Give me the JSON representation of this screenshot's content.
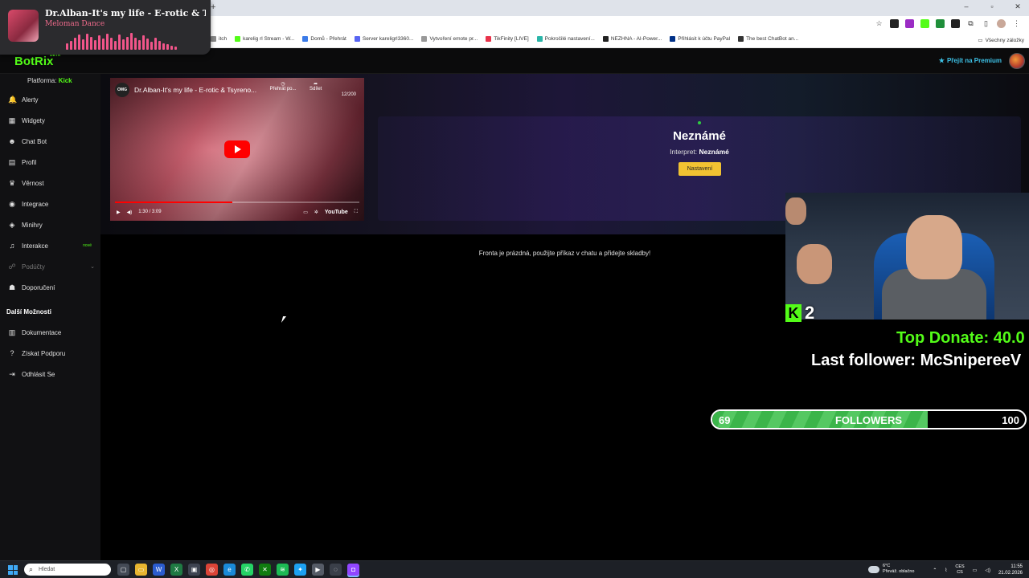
{
  "browser": {
    "bookmarks": [
      {
        "label": "itch",
        "color": "#888888"
      },
      {
        "label": "karelig rl Stream - W...",
        "color": "#53fc18"
      },
      {
        "label": "Domů - Přehrát",
        "color": "#3b7be8"
      },
      {
        "label": "Server kareligrl3360...",
        "color": "#5865f2"
      },
      {
        "label": "Vytvoření emote pr...",
        "color": "#999999"
      },
      {
        "label": "TikFinity [LIVE]",
        "color": "#e8334a"
      },
      {
        "label": "Pokročilé nastavení...",
        "color": "#2bb5a8"
      },
      {
        "label": "NEZHNA - AI-Power...",
        "color": "#222222"
      },
      {
        "label": "Přihlásit k účtu PayPal",
        "color": "#003087"
      },
      {
        "label": "The best ChatBot an...",
        "color": "#333333"
      }
    ],
    "all_bookmarks": "Všechny záložky"
  },
  "media": {
    "title": "Dr.Alban-It's my life - E-rotic & Tsy...",
    "artist": "Meloman Dance",
    "eq_levels": [
      0.35,
      0.5,
      0.7,
      0.85,
      0.6,
      0.9,
      0.75,
      0.55,
      0.8,
      0.65,
      0.9,
      0.7,
      0.5,
      0.85,
      0.6,
      0.75,
      0.95,
      0.7,
      0.55,
      0.8,
      0.65,
      0.45,
      0.7,
      0.5,
      0.35,
      0.3,
      0.25,
      0.2
    ],
    "eq_color": "#f2558a"
  },
  "app": {
    "brand": "BotRix",
    "beta": "BETA",
    "premium": "Přejít na Premium",
    "accent": "#53fc18"
  },
  "sidebar": {
    "platform_label": "Platforma:",
    "platform_value": "Kick",
    "items": [
      {
        "label": "Alerty",
        "icon": "bell-icon",
        "glyph": "🔔"
      },
      {
        "label": "Widgety",
        "icon": "grid-icon",
        "glyph": "▦"
      },
      {
        "label": "Chat Bot",
        "icon": "robot-icon",
        "glyph": "☻"
      },
      {
        "label": "Profil",
        "icon": "user-card-icon",
        "glyph": "▤"
      },
      {
        "label": "Věrnost",
        "icon": "trophy-icon",
        "glyph": "♛"
      },
      {
        "label": "Integrace",
        "icon": "plug-icon",
        "glyph": "◉"
      },
      {
        "label": "Minihry",
        "icon": "gamepad-icon",
        "glyph": "◈"
      },
      {
        "label": "Interakce",
        "icon": "music-note-icon",
        "glyph": "♫",
        "badge": "nové"
      },
      {
        "label": "Podúčty",
        "icon": "users-icon",
        "glyph": "☍"
      },
      {
        "label": "Doporučení",
        "icon": "people-icon",
        "glyph": "☗"
      }
    ],
    "more_label": "Další Možnosti",
    "more_items": [
      {
        "label": "Dokumentace",
        "icon": "book-icon",
        "glyph": "▥"
      },
      {
        "label": "Získat Podporu",
        "icon": "help-circle-icon",
        "glyph": "?"
      },
      {
        "label": "Odhlásit Se",
        "icon": "logout-icon",
        "glyph": "⇥"
      }
    ]
  },
  "video": {
    "channel_logo": "OMG",
    "title": "Dr.Alban-It's my life - E-rotic & Tsyreno...",
    "watch_later": "Přehrát po...",
    "share": "Sdílet",
    "counter": "12/200",
    "time": "1:30 / 3:09",
    "progress": 0.48,
    "youtube": "YouTube"
  },
  "player": {
    "song_title": "Neznámé",
    "artist_label": "Interpret:",
    "artist_value": "Neznámé",
    "settings_button": "Nastavení",
    "queue_empty": "Fronta je prázdná, použijte příkaz v chatu a přidejte skladby!"
  },
  "overlay": {
    "kick_letter": "K",
    "kick_count": "2",
    "top_donate": "Top Donate: 40.0",
    "last_follower": "Last follower: McSnipereeV",
    "followers_current": "69",
    "followers_label": "FOLLOWERS",
    "followers_goal": "100",
    "followers_progress": 0.69
  },
  "taskbar": {
    "search_placeholder": "Hledat",
    "apps": [
      {
        "icon": "task-view-icon",
        "color": "#444a55",
        "glyph": "▢"
      },
      {
        "icon": "file-explorer-icon",
        "color": "#e8b530",
        "glyph": "▭"
      },
      {
        "icon": "word-icon",
        "color": "#2b5ccf",
        "glyph": "W"
      },
      {
        "icon": "excel-icon",
        "color": "#1f7a43",
        "glyph": "X"
      },
      {
        "icon": "store-icon",
        "color": "#3d4350",
        "glyph": "▣"
      },
      {
        "icon": "chrome-icon",
        "color": "#db4437",
        "glyph": "◎"
      },
      {
        "icon": "edge-icon",
        "color": "#1a8ad8",
        "glyph": "e"
      },
      {
        "icon": "whatsapp-icon",
        "color": "#25d366",
        "glyph": "✆"
      },
      {
        "icon": "xbox-icon",
        "color": "#107c10",
        "glyph": "✕"
      },
      {
        "icon": "spotify-icon",
        "color": "#1db954",
        "glyph": "≋"
      },
      {
        "icon": "twitter-icon",
        "color": "#1da1f2",
        "glyph": "✦"
      },
      {
        "icon": "media-player-icon",
        "color": "#555b66",
        "glyph": "▶"
      },
      {
        "icon": "obs-icon",
        "color": "#3a3f49",
        "glyph": "◌"
      },
      {
        "icon": "streamlabs-icon",
        "color": "#9146ff",
        "glyph": "◘"
      }
    ],
    "weather_temp": "6°C",
    "weather_desc": "Převáž. oblačno",
    "lang_top": "CES",
    "lang_bottom": "CS",
    "time": "11:55",
    "date": "21.02.2026"
  }
}
